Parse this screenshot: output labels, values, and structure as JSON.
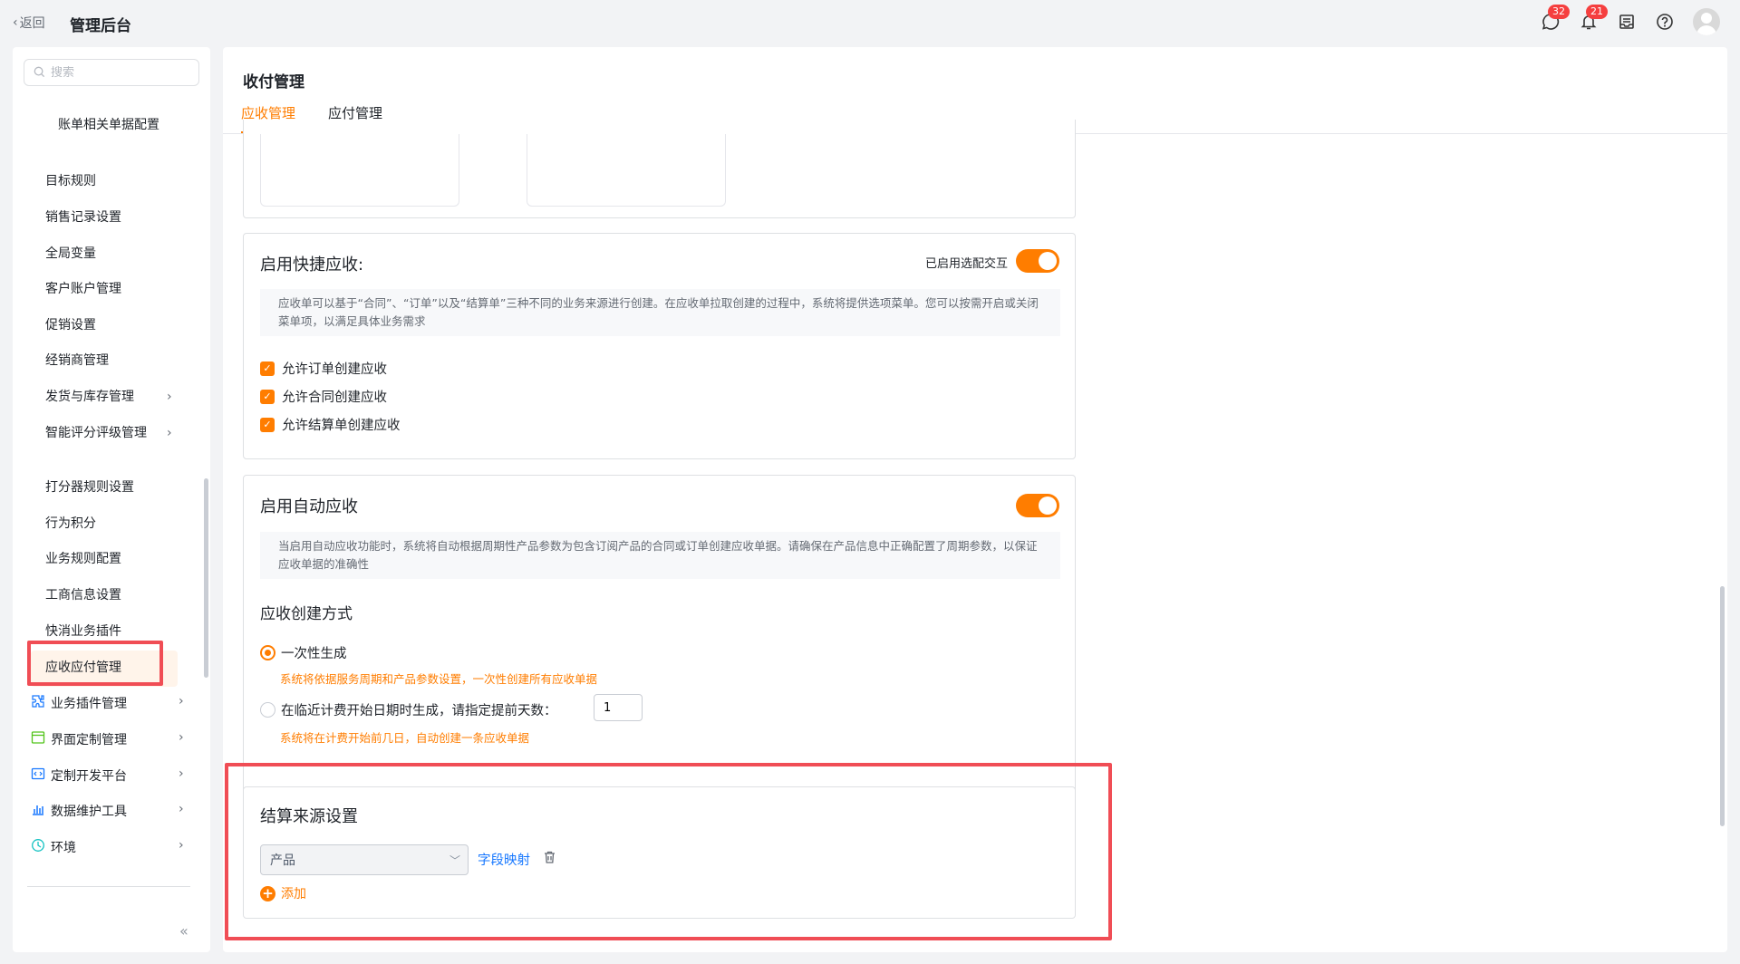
{
  "topbar": {
    "back_label": "返回",
    "title": "管理后台",
    "chat_badge": "32",
    "bell_badge": "21"
  },
  "sidebar": {
    "search_placeholder": "搜索",
    "items": [
      {
        "label": "账单相关单据配置"
      },
      {
        "label": "目标规则"
      },
      {
        "label": "销售记录设置"
      },
      {
        "label": "全局变量"
      },
      {
        "label": "客户账户管理"
      },
      {
        "label": "促销设置"
      },
      {
        "label": "经销商管理"
      },
      {
        "label": "发货与库存管理"
      },
      {
        "label": "智能评分评级管理"
      },
      {
        "label": "打分器规则设置"
      },
      {
        "label": "行为积分"
      },
      {
        "label": "业务规则配置"
      },
      {
        "label": "工商信息设置"
      },
      {
        "label": "快消业务插件"
      },
      {
        "label": "应收应付管理"
      }
    ],
    "groups": [
      {
        "label": "业务插件管理"
      },
      {
        "label": "界面定制管理"
      },
      {
        "label": "定制开发平台"
      },
      {
        "label": "数据维护工具"
      },
      {
        "label": "环境"
      }
    ]
  },
  "main": {
    "title": "收付管理",
    "tabs": [
      {
        "label": "应收管理"
      },
      {
        "label": "应付管理"
      }
    ],
    "quick": {
      "title": "启用快捷应收:",
      "toggle_label": "已启用选配交互",
      "desc": "应收单可以基于“合同”、“订单”以及“结算单”三种不同的业务来源进行创建。在应收单拉取创建的过程中，系统将提供选项菜单。您可以按需开启或关闭菜单项，以满足具体业务需求",
      "options": [
        {
          "label": "允许订单创建应收"
        },
        {
          "label": "允许合同创建应收"
        },
        {
          "label": "允许结算单创建应收"
        }
      ]
    },
    "auto": {
      "title": "启用自动应收",
      "desc": "当启用自动应收功能时，系统将自动根据周期性产品参数为包含订阅产品的合同或订单创建应收单据。请确保在产品信息中正确配置了周期参数，以保证应收单据的准确性",
      "method_title": "应收创建方式",
      "radio1": "一次性生成",
      "radio1_hint": "系统将依据服务周期和产品参数设置，一次性创建所有应收单据",
      "radio2": "在临近计费开始日期时生成，请指定提前天数：",
      "radio2_value": "1",
      "radio2_hint": "系统将在计费开始前几日，自动创建一条应收单据"
    },
    "settlement": {
      "title": "结算来源设置",
      "select_value": "产品",
      "field_mapping": "字段映射",
      "add_label": "添加"
    }
  }
}
